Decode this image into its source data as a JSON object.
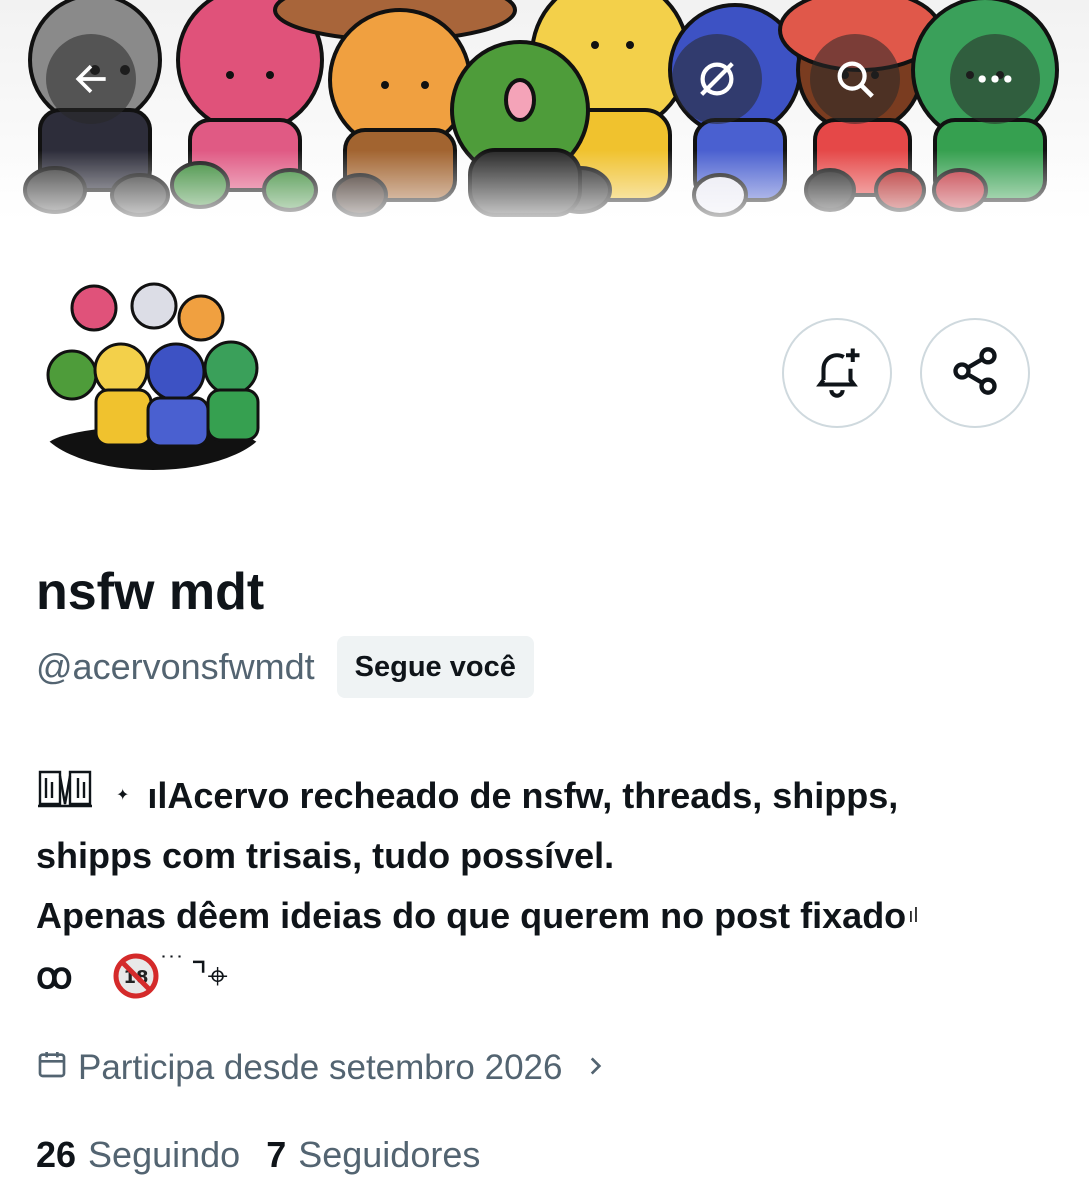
{
  "header": {
    "back_icon": "arrow-left-icon",
    "grok_icon": "grok-icon",
    "search_icon": "search-icon",
    "more_icon": "more-horizontal-icon"
  },
  "banner": {
    "description_icon": "illustrated-banner"
  },
  "actions": {
    "notify_icon": "bell-plus-icon",
    "share_icon": "share-icon"
  },
  "profile": {
    "display_name": "nsfw mdt",
    "handle": "@acervonsfwmdt",
    "follows_you": "Segue você",
    "bio": {
      "line1_prefix": "ılAcervo recheado de nsfw, threads, shipps,",
      "line2": "shipps com trisais, tudo possível.",
      "line3": "Apenas dêem ideias do que querem no post fixado",
      "line3_suffix": "ıl",
      "line4_a": "ꝏ",
      "line4_b": "🔞",
      "line4_c": "˙˙˙",
      "line4_d": "⌝⌖"
    },
    "joined": "Participa desde setembro 2026",
    "following_count": "26",
    "following_label": "Seguindo",
    "followers_count": "7",
    "followers_label": "Seguidores"
  },
  "colors": {
    "text": "#0f1419",
    "secondary": "#536471",
    "border": "#cfd9de",
    "badge_bg": "#eff3f4"
  }
}
